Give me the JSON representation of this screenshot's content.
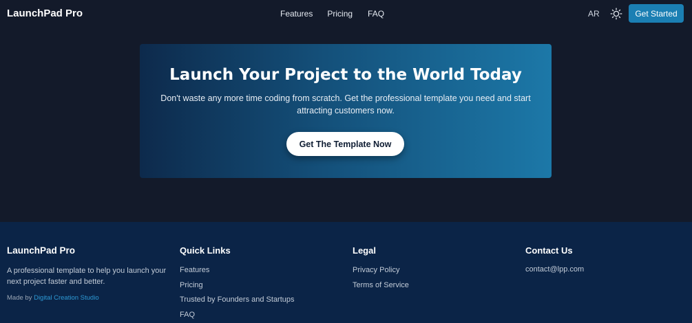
{
  "header": {
    "brand": "LaunchPad Pro",
    "nav": [
      "Features",
      "Pricing",
      "FAQ"
    ],
    "lang": "AR",
    "theme_icon": "sun-icon",
    "cta": "Get Started"
  },
  "hero": {
    "title": "Launch Your Project to the World Today",
    "subtitle": "Don't waste any more time coding from scratch. Get the professional template you need and start attracting customers now.",
    "button": "Get The Template Now"
  },
  "footer": {
    "brand": "LaunchPad Pro",
    "description": "A professional template to help you launch your next project faster and better.",
    "made_by_prefix": "Made by",
    "made_by_link": "Digital Creation Studio",
    "quick_links_title": "Quick Links",
    "quick_links": [
      "Features",
      "Pricing",
      "Trusted by Founders and Startups",
      "FAQ"
    ],
    "legal_title": "Legal",
    "legal_links": [
      "Privacy Policy",
      "Terms of Service"
    ],
    "contact_title": "Contact Us",
    "contact_email": "contact@lpp.com"
  },
  "colors": {
    "background": "#131a2a",
    "footer_bg": "#0b2447",
    "accent": "#1b7fb3",
    "link": "#2d9ad6"
  }
}
